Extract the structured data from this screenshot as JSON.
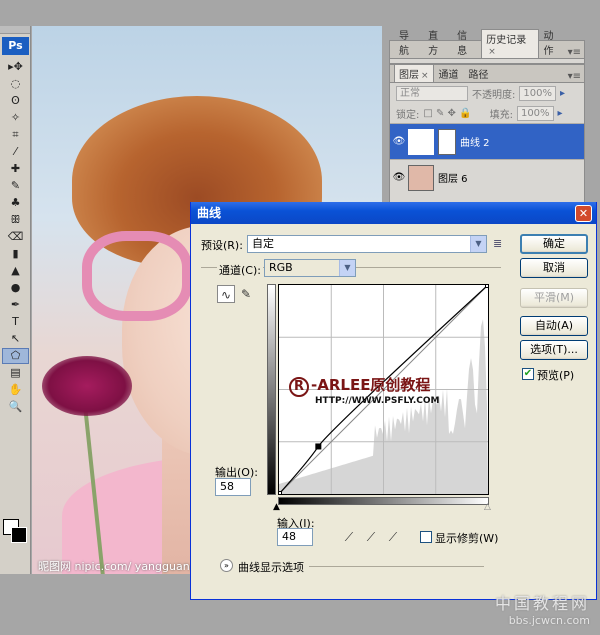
{
  "toolbox": {
    "logo": "Ps",
    "tools": [
      "▸✥",
      "◌",
      "ʘ",
      "✧",
      "⌗",
      "⁄",
      "✚",
      "✎",
      "♣",
      "ꕥ",
      "⌫",
      "▮",
      "▲",
      "●",
      "✒",
      "T",
      "↖",
      "⬠",
      "▤",
      "✋",
      "🔍"
    ]
  },
  "image": {
    "watermark": "昵图网 nipic.com/ yangguang"
  },
  "history_panel": {
    "tabs": [
      "导航",
      "直方",
      "信息",
      "历史记录",
      "动作"
    ]
  },
  "layers_panel": {
    "tabs": [
      "图层",
      "通道",
      "路径"
    ],
    "blend_mode": "正常",
    "opacity_label": "不透明度:",
    "opacity_value": "100%",
    "lock_label": "锁定:",
    "fill_label": "填充:",
    "fill_value": "100%",
    "layers": [
      {
        "name": "曲线 2",
        "selected": true
      },
      {
        "name": "图层 6",
        "selected": false
      }
    ]
  },
  "curves": {
    "title": "曲线",
    "preset_label": "预设(R):",
    "preset_value": "自定",
    "channel_label": "通道(C):",
    "channel_value": "RGB",
    "output_label": "输出(O):",
    "output_value": "58",
    "input_label": "输入(I):",
    "input_value": "48",
    "buttons": {
      "ok": "确定",
      "cancel": "取消",
      "smooth": "平滑(M)",
      "auto": "自动(A)",
      "options": "选项(T)..."
    },
    "preview_label": "预览(P)",
    "preview_checked": true,
    "show_clipping_label": "显示修剪(W)",
    "show_clipping_checked": false,
    "display_options_label": "曲线显示选项",
    "overlay_logo": "-ARLEE原创教程",
    "overlay_logo_mark": "R",
    "overlay_url": "HTTP://WWW.PSFLY.COM",
    "curve_points": [
      [
        0,
        0
      ],
      [
        48,
        58
      ],
      [
        255,
        255
      ]
    ]
  },
  "site_watermark": {
    "main": "中国教程网",
    "sub": "bbs.jcwcn.com"
  }
}
